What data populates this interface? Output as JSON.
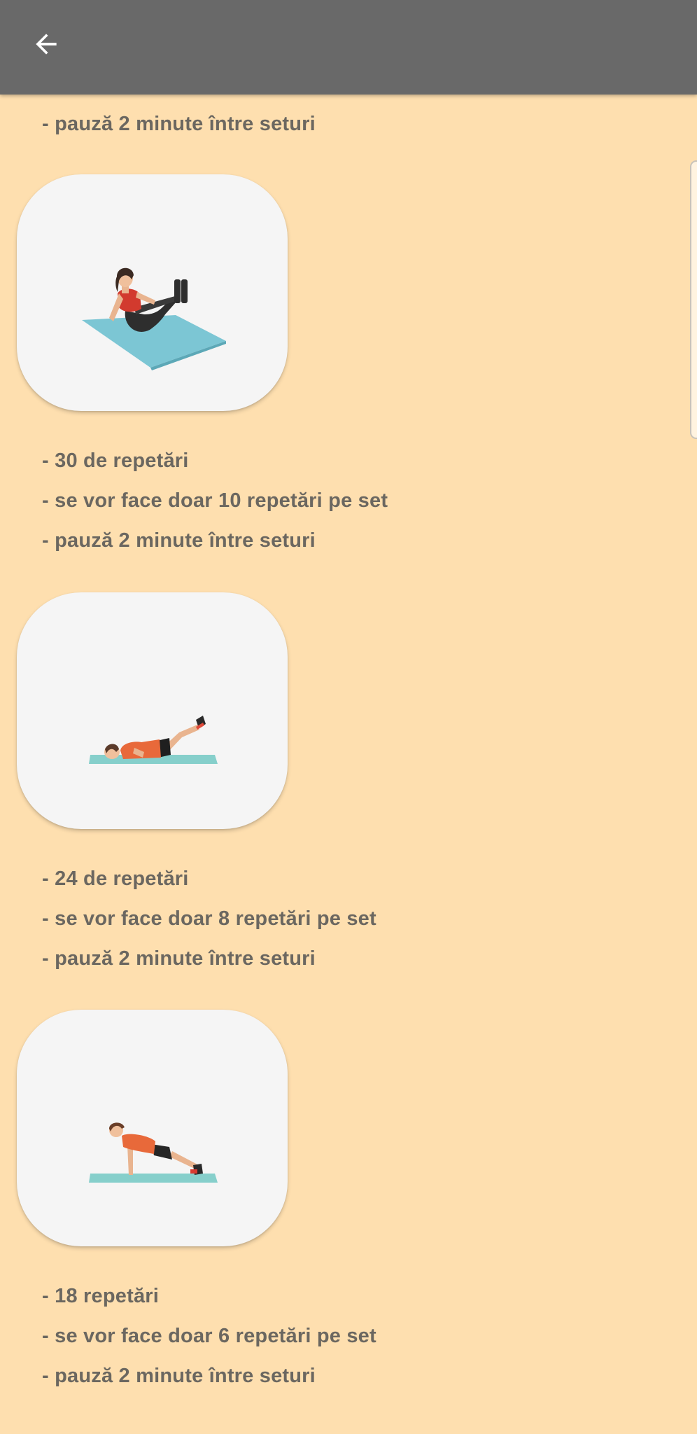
{
  "toolbar": {
    "back_icon": "arrow-back-icon",
    "background": "#696969"
  },
  "theme": {
    "page_background": "#FEDFAF",
    "card_background": "#F5F5F5",
    "text_color": "#6B6760"
  },
  "top_text": "- pauză 2 minute între seturi",
  "exercises": [
    {
      "illustration": "seated-knee-tuck-illustration",
      "lines": [
        "- 30 de repetări",
        "- se vor face doar 10 repetări pe set",
        "- pauză 2 minute între seturi"
      ]
    },
    {
      "illustration": "lying-leg-raise-illustration",
      "lines": [
        "- 24 de repetări",
        "- se vor face doar 8 repetări pe set",
        "- pauză 2 minute între seturi"
      ]
    },
    {
      "illustration": "push-up-illustration",
      "lines": [
        "- 18 repetări",
        "- se vor face doar 6 repetări pe set",
        "- pauză 2 minute între seturi"
      ]
    }
  ]
}
